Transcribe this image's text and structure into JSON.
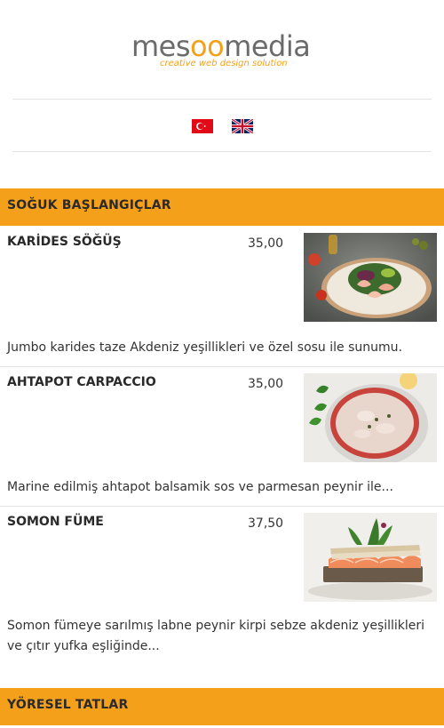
{
  "brand": {
    "logo_part1": "mes",
    "logo_part2": "oo",
    "logo_part3": "media",
    "tagline": "creative web design solution",
    "accent_color": "#f5a01a"
  },
  "languages": [
    {
      "code": "tr",
      "icon": "turkey-flag-icon"
    },
    {
      "code": "en",
      "icon": "uk-flag-icon"
    }
  ],
  "categories": [
    {
      "title": "SOĞUK BAŞLANGIÇLAR",
      "items": [
        {
          "name": "KARİDES SÖĞÜŞ",
          "price": "35,00",
          "description": "Jumbo karides taze Akdeniz yeşillikleri ve özel sosu ile sunumu.",
          "photo": "shrimp-salad-photo"
        },
        {
          "name": "AHTAPOT CARPACCIO",
          "price": "35,00",
          "description": "Marine edilmiş ahtapot balsamik sos ve parmesan peynir ile...",
          "photo": "octopus-carpaccio-photo"
        },
        {
          "name": "SOMON FÜME",
          "price": "37,50",
          "description": "Somon fümeye sarılmış labne peynir kirpi sebze akdeniz yeşillikleri ve çıtır yufka eşliğinde...",
          "photo": "smoked-salmon-photo"
        }
      ]
    },
    {
      "title": "YÖRESEL TATLAR",
      "items": []
    }
  ]
}
